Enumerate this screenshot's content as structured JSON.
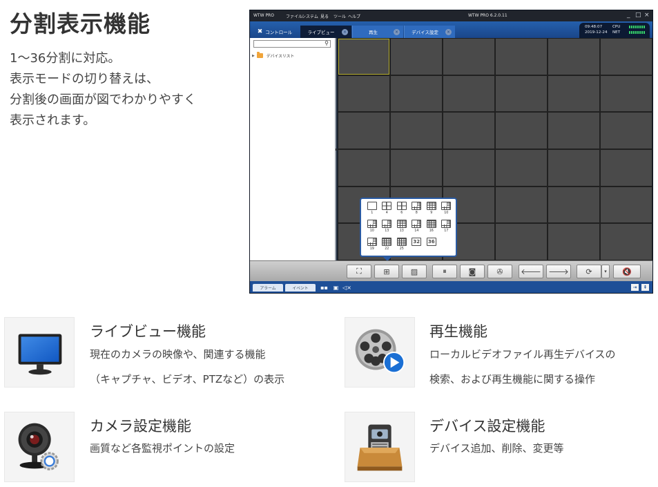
{
  "page": {
    "title": "分割表示機能",
    "intro": [
      "1〜36分割に対応。",
      "表示モードの切り替えは、",
      "分割後の画面が図でわかりやすく",
      "表示されます。"
    ]
  },
  "app": {
    "window_title": "WTW PRO",
    "menu": [
      "ファイル",
      "システム",
      "見る",
      "ツール",
      "ヘルプ"
    ],
    "version": "WTW PRO 6.2.0.11",
    "window_controls": [
      "_",
      "□",
      "×"
    ],
    "tabs": [
      {
        "label": "コントロール",
        "icon": "tools-icon"
      },
      {
        "label": "ライブビュー",
        "closable": true,
        "active": true
      },
      {
        "label": "再生",
        "closable": true
      },
      {
        "label": "デバイス設定",
        "closable": true
      }
    ],
    "status": {
      "time": "09:48:07",
      "date": "2019-12-24",
      "cpu_label": "CPU",
      "net_label": "NET"
    },
    "tree": {
      "search_value": "",
      "items": [
        {
          "label": "デバイスリスト",
          "icon": "folder-icon"
        }
      ]
    },
    "grid": {
      "rows": 6,
      "cols": 6,
      "selected_index": 0
    },
    "layout_options": [
      {
        "label": "1",
        "icon": "layout-1-icon"
      },
      {
        "label": "4",
        "icon": "layout-4-icon"
      },
      {
        "label": "6",
        "icon": "layout-6-icon"
      },
      {
        "label": "8",
        "icon": "layout-8-icon"
      },
      {
        "label": "9",
        "icon": "layout-9-icon"
      },
      {
        "label": "10",
        "icon": "layout-10-icon"
      },
      {
        "label": "10",
        "icon": "layout-10b-icon"
      },
      {
        "label": "13",
        "icon": "layout-13-icon"
      },
      {
        "label": "13",
        "icon": "layout-13b-icon"
      },
      {
        "label": "14",
        "icon": "layout-14-icon"
      },
      {
        "label": "16",
        "icon": "layout-16-icon"
      },
      {
        "label": "17",
        "icon": "layout-17-icon"
      },
      {
        "label": "19",
        "icon": "layout-19-icon"
      },
      {
        "label": "22",
        "icon": "layout-22-icon"
      },
      {
        "label": "25",
        "icon": "layout-25-icon"
      },
      {
        "label": "32",
        "icon": "layout-32-icon",
        "text": "32"
      },
      {
        "label": "36",
        "icon": "layout-36-icon",
        "text": "36"
      }
    ],
    "toolbar": [
      {
        "icon": "fullscreen-icon",
        "glyph": "⛶"
      },
      {
        "icon": "layout-split-icon",
        "glyph": "⊞"
      },
      {
        "icon": "image-search-icon",
        "glyph": "▨"
      },
      {
        "icon": "pause-icon",
        "glyph": "⏸"
      },
      {
        "icon": "camera-snapshot-icon",
        "glyph": "◙"
      },
      {
        "icon": "reel-icon",
        "glyph": "✇"
      },
      {
        "icon": "arrow-left-icon",
        "glyph": "🡐"
      },
      {
        "icon": "arrow-right-icon",
        "glyph": "🡒"
      },
      {
        "icon": "refresh-icon",
        "glyph": "⟳"
      },
      {
        "icon": "dropdown-icon",
        "glyph": "▾"
      },
      {
        "icon": "mute-icon",
        "glyph": "🔇"
      }
    ],
    "status_tabs": [
      "アラーム",
      "イベント"
    ]
  },
  "features": [
    {
      "title": "ライブビュー機能",
      "lines": [
        "現在のカメラの映像や、関連する機能",
        "（キャプチャ、ビデオ、PTZなど）の表示"
      ],
      "icon": "monitor-icon"
    },
    {
      "title": "再生機能",
      "lines": [
        "ローカルビデオファイル再生デバイスの",
        "検索、および再生機能に関する操作"
      ],
      "icon": "film-reel-play-icon"
    },
    {
      "title": "カメラ設定機能",
      "lines": [
        "画質など各監視ポイントの設定"
      ],
      "icon": "webcam-settings-icon"
    },
    {
      "title": "デバイス設定機能",
      "lines": [
        "デバイス追加、削除、変更等"
      ],
      "icon": "device-box-icon"
    }
  ],
  "colors": {
    "accent_blue": "#2560ad",
    "grid_cell": "#4a4a4a",
    "selected_cell": "#b5ad2d",
    "status_green": "#36d36b"
  }
}
